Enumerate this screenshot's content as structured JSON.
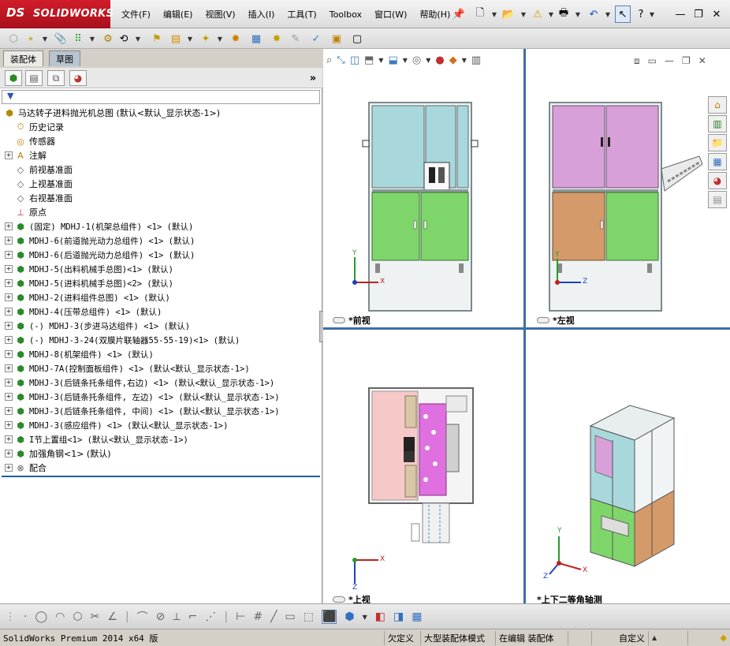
{
  "app": {
    "logo_ds": "DS",
    "logo_name": "SOLIDWORKS"
  },
  "menu": [
    "文件(F)",
    "编辑(E)",
    "视图(V)",
    "插入(I)",
    "工具(T)",
    "Toolbox",
    "窗口(W)",
    "帮助(H)"
  ],
  "panel_tabs": [
    "装配体",
    "草图"
  ],
  "tree": {
    "root": "马达转子进料抛光机总图  (默认<默认_显示状态-1>)",
    "items": [
      {
        "label": "历史记录",
        "icon": "history-icon",
        "expandable": false
      },
      {
        "label": "传感器",
        "icon": "sensor-icon",
        "expandable": false
      },
      {
        "label": "注解",
        "icon": "annotation-icon",
        "expandable": true
      },
      {
        "label": "前视基准面",
        "icon": "plane-icon",
        "expandable": false
      },
      {
        "label": "上视基准面",
        "icon": "plane-icon",
        "expandable": false
      },
      {
        "label": "右视基准面",
        "icon": "plane-icon",
        "expandable": false
      },
      {
        "label": "原点",
        "icon": "origin-icon",
        "expandable": false
      },
      {
        "label": "(固定) MDHJ-1(机架总组件) <1> (默认)",
        "icon": "assembly-icon",
        "expandable": true
      },
      {
        "label": "MDHJ-6(前道抛光动力总组件) <1> (默认)",
        "icon": "assembly-icon",
        "expandable": true
      },
      {
        "label": "MDHJ-6(后道抛光动力总组件) <1> (默认)",
        "icon": "assembly-icon",
        "expandable": true
      },
      {
        "label": "MDHJ-5(出料机械手总图)<1> (默认)",
        "icon": "assembly-icon",
        "expandable": true
      },
      {
        "label": "MDHJ-5(进料机械手总图)<2> (默认)",
        "icon": "assembly-icon",
        "expandable": true
      },
      {
        "label": "MDHJ-2(进料组件总图) <1> (默认)",
        "icon": "assembly-icon",
        "expandable": true
      },
      {
        "label": "MDHJ-4(压带总组件) <1> (默认)",
        "icon": "assembly-icon",
        "expandable": true
      },
      {
        "label": "(-) MDHJ-3(步进马达组件) <1> (默认)",
        "icon": "assembly-icon",
        "expandable": true
      },
      {
        "label": "(-) MDHJ-3-24(双膜片联轴器55-55-19)<1> (默认)",
        "icon": "assembly-icon",
        "expandable": true
      },
      {
        "label": "MDHJ-8(机架组件) <1> (默认)",
        "icon": "assembly-icon",
        "expandable": true
      },
      {
        "label": "MDHJ-7A(控制面板组件) <1> (默认<默认_显示状态-1>)",
        "icon": "assembly-icon",
        "expandable": true
      },
      {
        "label": "MDHJ-3(后链条托条组件,右边) <1> (默认<默认_显示状态-1>)",
        "icon": "assembly-icon",
        "expandable": true
      },
      {
        "label": "MDHJ-3(后链条托条组件, 左边) <1> (默认<默认_显示状态-1>)",
        "icon": "assembly-icon",
        "expandable": true
      },
      {
        "label": "MDHJ-3(后链条托条组件, 中间) <1> (默认<默认_显示状态-1>)",
        "icon": "assembly-icon",
        "expandable": true
      },
      {
        "label": "MDHJ-3(感应组件) <1> (默认<默认_显示状态-1>)",
        "icon": "assembly-icon",
        "expandable": true
      },
      {
        "label": "I节上置组<1> (默认<默认_显示状态-1>)",
        "icon": "assembly-icon",
        "expandable": true
      },
      {
        "label": "加强角钢<1> (默认)",
        "icon": "assembly-icon",
        "expandable": true
      },
      {
        "label": "配合",
        "icon": "mates-icon",
        "expandable": true
      }
    ]
  },
  "viewports": {
    "front": "*前视",
    "left": "*左视",
    "top": "*上视",
    "iso": "*上下二等角轴测"
  },
  "axes": {
    "x": "X",
    "y": "Y",
    "z": "Z"
  },
  "status": {
    "product": "SolidWorks Premium 2014 x64 版",
    "defined": "欠定义",
    "mode": "大型装配体模式",
    "editing": "在编辑 装配体",
    "units": "自定义"
  },
  "colors": {
    "cabinet_blue": "#a8d8dc",
    "cabinet_green": "#7ed66a",
    "cabinet_pink": "#d8a0d8",
    "cabinet_brown": "#d49a6a",
    "frame_gray": "#a8b4b4",
    "logo_red": "#c8102e"
  }
}
